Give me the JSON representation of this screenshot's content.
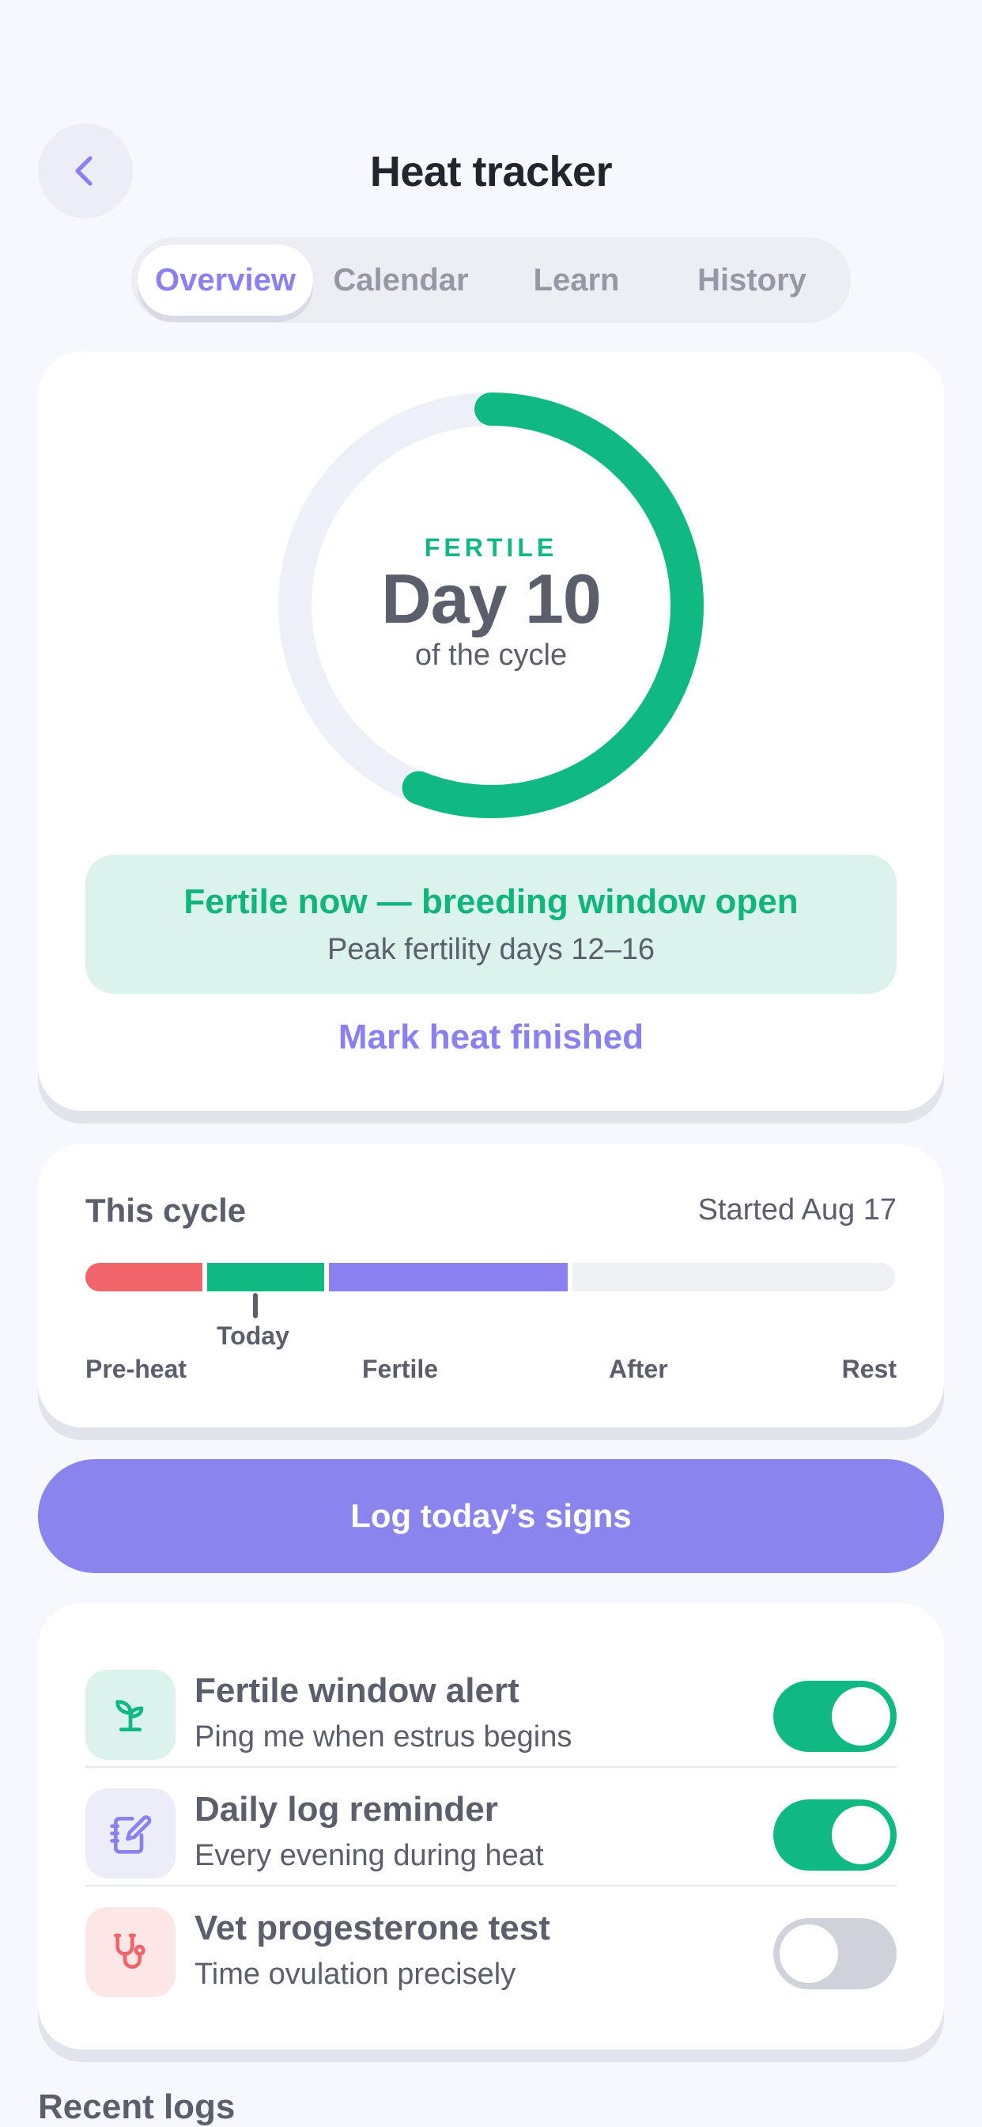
{
  "header": {
    "title": "Heat tracker"
  },
  "tabs": [
    {
      "label": "Overview",
      "active": true
    },
    {
      "label": "Calendar",
      "active": false
    },
    {
      "label": "Learn",
      "active": false
    },
    {
      "label": "History",
      "active": false
    }
  ],
  "ring": {
    "phase": "FERTILE",
    "day": "Day 10",
    "subtitle": "of the cycle",
    "progress_fraction": 0.56,
    "color": "#10b981"
  },
  "status": {
    "title": "Fertile now — breeding window open",
    "subtitle": "Peak fertility days 12–16"
  },
  "actions": {
    "mark_finished": "Mark heat finished",
    "log_signs": "Log today’s signs"
  },
  "this_cycle": {
    "title": "This cycle",
    "started": "Started Aug 17",
    "today_label": "Today",
    "phases": [
      "Pre-heat",
      "Fertile",
      "After",
      "Rest"
    ],
    "phase_colors": [
      "#f0646a",
      "#10b981",
      "#8a80ef",
      "#eff0f3"
    ]
  },
  "reminders": [
    {
      "title": "Fertile window alert",
      "subtitle": "Ping me when estrus begins",
      "icon": "sprout-icon",
      "enabled": true
    },
    {
      "title": "Daily log reminder",
      "subtitle": "Every evening during heat",
      "icon": "notebook-pen-icon",
      "enabled": true
    },
    {
      "title": "Vet progesterone test",
      "subtitle": "Time ovulation precisely",
      "icon": "stethoscope-icon",
      "enabled": false
    }
  ],
  "recent_logs": {
    "title": "Recent logs"
  }
}
